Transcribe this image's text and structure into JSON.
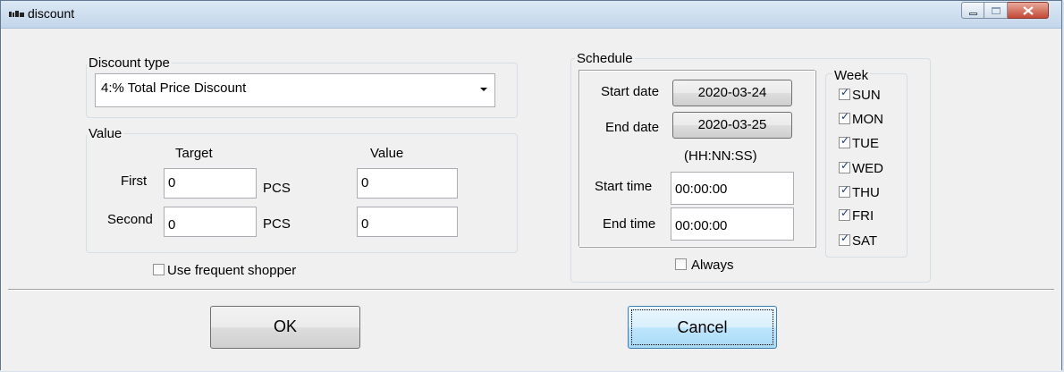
{
  "window": {
    "title": "discount"
  },
  "discount_type": {
    "legend": "Discount type",
    "selected": "4:% Total Price Discount"
  },
  "value_group": {
    "legend": "Value",
    "target_header": "Target",
    "value_header": "Value",
    "rows": [
      {
        "label": "First",
        "target": "0",
        "unit": "PCS",
        "value": "0"
      },
      {
        "label": "Second",
        "target": "0",
        "unit": "PCS",
        "value": "0"
      }
    ]
  },
  "use_frequent_shopper": {
    "label": "Use frequent shopper",
    "checked": false
  },
  "schedule": {
    "legend": "Schedule",
    "start_date_label": "Start date",
    "start_date": "2020-03-24",
    "end_date_label": "End date",
    "end_date": "2020-03-25",
    "time_format_hint": "(HH:NN:SS)",
    "start_time_label": "Start time",
    "start_time": "00:00:00",
    "end_time_label": "End time",
    "end_time": "00:00:00"
  },
  "week": {
    "legend": "Week",
    "days": [
      {
        "label": "SUN",
        "checked": true
      },
      {
        "label": "MON",
        "checked": true
      },
      {
        "label": "TUE",
        "checked": true
      },
      {
        "label": "WED",
        "checked": true
      },
      {
        "label": "THU",
        "checked": true
      },
      {
        "label": "FRI",
        "checked": true
      },
      {
        "label": "SAT",
        "checked": true
      }
    ]
  },
  "always": {
    "label": "Always",
    "checked": false
  },
  "buttons": {
    "ok": "OK",
    "cancel": "Cancel"
  }
}
